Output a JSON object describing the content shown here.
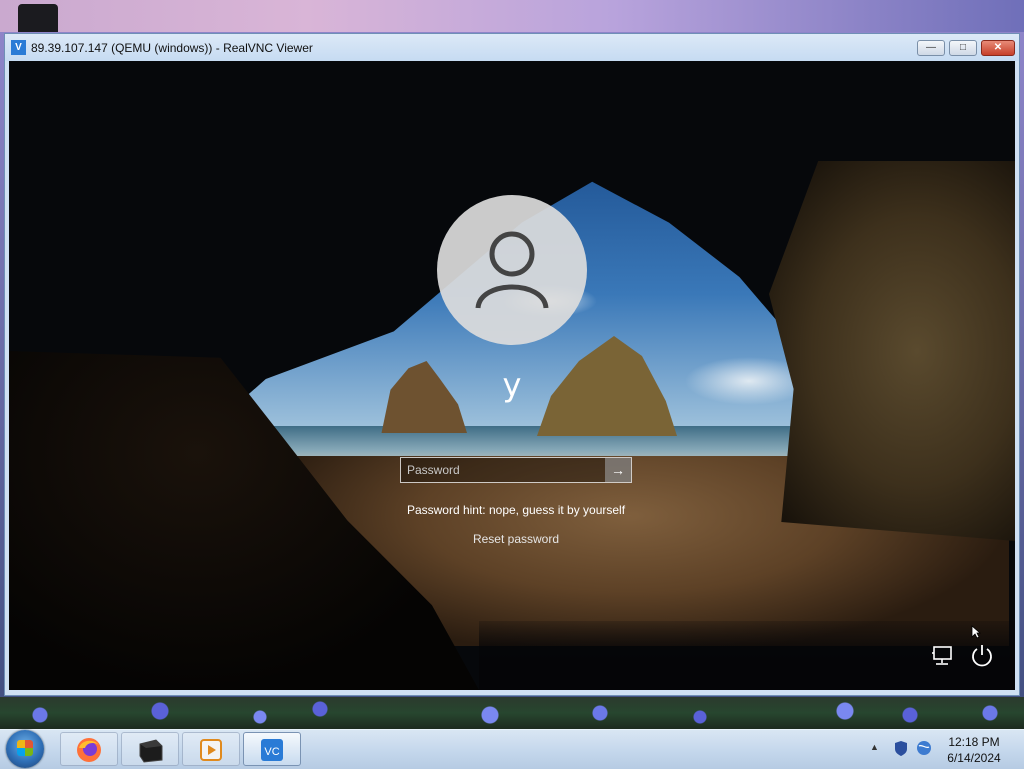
{
  "window": {
    "title": "89.39.107.147 (QEMU (windows)) - RealVNC Viewer",
    "app_icon": "realvnc-icon",
    "minimize_label": "—",
    "maximize_label": "□",
    "close_label": "✕"
  },
  "lock_screen": {
    "username": "y",
    "password_placeholder": "Password",
    "password_value": "",
    "submit_glyph": "→",
    "hint": "Password hint: nope, guess it by yourself",
    "reset_link": "Reset password",
    "icons": [
      "user-avatar-icon",
      "network-icon",
      "power-icon"
    ]
  },
  "taskbar": {
    "apps": [
      {
        "name": "firefox",
        "icon": "firefox-icon"
      },
      {
        "name": "terminal",
        "icon": "terminal-icon"
      },
      {
        "name": "media-player",
        "icon": "media-player-icon"
      },
      {
        "name": "realvnc",
        "icon": "realvnc-icon",
        "active": true
      }
    ],
    "tray_arrow": "▲",
    "clock_time": "12:18 PM",
    "clock_date": "6/14/2024"
  },
  "colors": {
    "accent": "#2a7bd6",
    "close_button": "#c6402a"
  }
}
